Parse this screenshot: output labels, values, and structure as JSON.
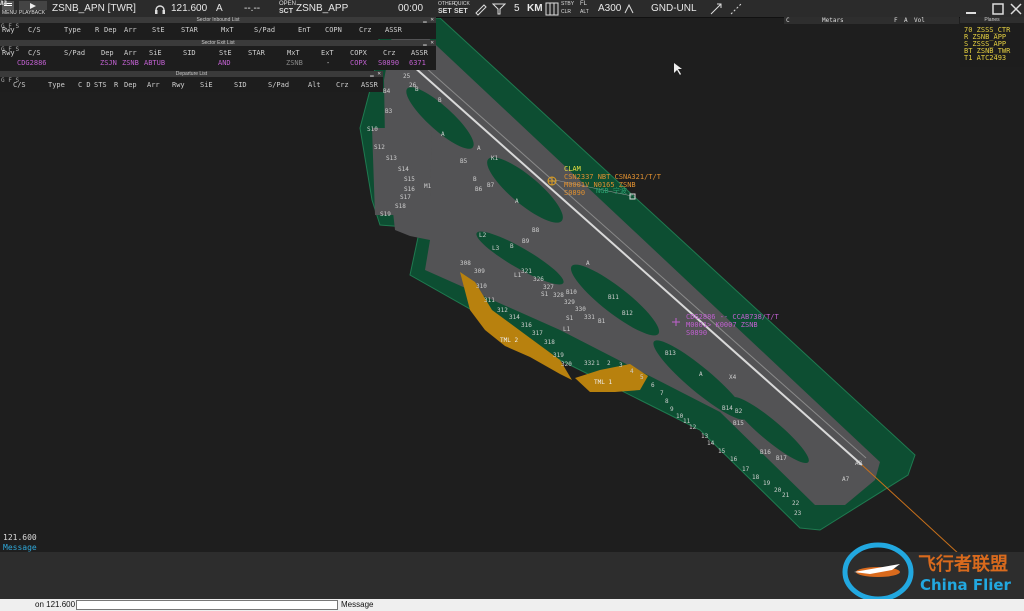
{
  "topbar": {
    "menu_label": "MENU",
    "playback_label": "PLAYBACK",
    "position_name": "ZSNB_APN [TWR]",
    "frequency": "121.600",
    "freq_mode": "A",
    "dash_value": "--.--",
    "open_label": "OPEN",
    "sct_label": "SCT",
    "sector_name": "ZSNB_APP",
    "clock": "00:00",
    "other_label": "OTHER",
    "quick_label": "QUICK",
    "set_label_1": "SET",
    "set_label_2": "SET",
    "range_value": "5",
    "range_unit": "KM",
    "stby_label": "STBY",
    "clr_label": "CLR",
    "fl_label": "FL",
    "alt_label": "ALT",
    "alt_value": "A300",
    "gnd_mode": "GND-UNL"
  },
  "inbound": {
    "title": "Sector Inbound List",
    "opts": "G F S",
    "columns": [
      "Rwy",
      "C/S",
      "Type",
      "R",
      "Dep",
      "Arr",
      "StE",
      "STAR",
      "MxT",
      "S/Pad",
      "EnT",
      "COPN",
      "Crz",
      "ASSR"
    ]
  },
  "exit": {
    "title": "Sector Exit List",
    "opts": "G F S",
    "columns": [
      "Rwy",
      "C/S",
      "S/Pad",
      "Dep",
      "Arr",
      "SiE",
      "SID",
      "StE",
      "STAR",
      "MxT",
      "ExT",
      "COPX",
      "Crz",
      "ASSR"
    ],
    "row": [
      "CDG2886",
      "ZSJN",
      "ZSNB",
      "ABTUB",
      "AND",
      "ZSNB",
      "-",
      "COPX",
      "S0890",
      "6371"
    ]
  },
  "departure": {
    "title": "Departure List",
    "opts": "G F S",
    "columns": [
      "C/S",
      "Type",
      "C D",
      "STS",
      "R",
      "Dep",
      "Arr",
      "Rwy",
      "SiE",
      "SID",
      "S/Pad",
      "Alt",
      "Crz",
      "ASSR"
    ]
  },
  "tabs": {
    "c_label": "C",
    "metars": "Metars",
    "f_label": "F",
    "a_label": "A",
    "vol_label": "Vol"
  },
  "planes": {
    "title": "Planes",
    "rows": [
      "70 ZSSS_CTR",
      "R ZSNB_APP",
      "S ZSSS_APP",
      "BT ZSNB_TWR",
      "T1 ATC2493"
    ]
  },
  "map": {
    "track1": {
      "line1": "CLAM",
      "line2": "CSN2337 NBT CSNA321/T/T",
      "line3": "M0001V N0165 ZSNB",
      "line4": "S0890"
    },
    "track1_tag": "NGB 宁波",
    "track2": {
      "line1": "CDG2886 -- CCAB738/T/T",
      "line2": "M0001> K0007 ZSNB",
      "line3": "S0890"
    },
    "terminals": [
      "TML 2",
      "TML 1"
    ],
    "taxi_labels": [
      "A",
      "A",
      "A",
      "A",
      "A",
      "B",
      "B",
      "B",
      "B",
      "B1",
      "B2",
      "B3",
      "B4",
      "B5",
      "B6",
      "B7",
      "B8",
      "B9",
      "B10",
      "B11",
      "B12",
      "B13",
      "B14",
      "B15",
      "B16",
      "B17",
      "K1",
      "L1",
      "L1",
      "L2",
      "L3",
      "S1",
      "S1",
      "M1",
      "X4",
      "A7",
      "S10",
      "S12",
      "S13",
      "S14",
      "S15",
      "S16",
      "S17",
      "S18",
      "S19",
      "308",
      "309",
      "310",
      "311",
      "312",
      "314",
      "316",
      "317",
      "318",
      "319",
      "320",
      "321",
      "326",
      "327",
      "328",
      "329",
      "330",
      "331",
      "332",
      "1",
      "2",
      "3",
      "4",
      "5",
      "6",
      "7",
      "8",
      "9",
      "10",
      "11",
      "12",
      "13",
      "14",
      "15",
      "16",
      "17",
      "18",
      "19",
      "20",
      "21",
      "22",
      "23",
      "24",
      "25",
      "26",
      "A2",
      "A3",
      "A4",
      "31"
    ]
  },
  "bottom": {
    "freq_readout": "121.600",
    "message_label": "Message",
    "input_prefix": "on 121.600",
    "message_field_label": "Message"
  },
  "watermark": {
    "cn": "飞行者联盟",
    "en": "China Flier"
  }
}
